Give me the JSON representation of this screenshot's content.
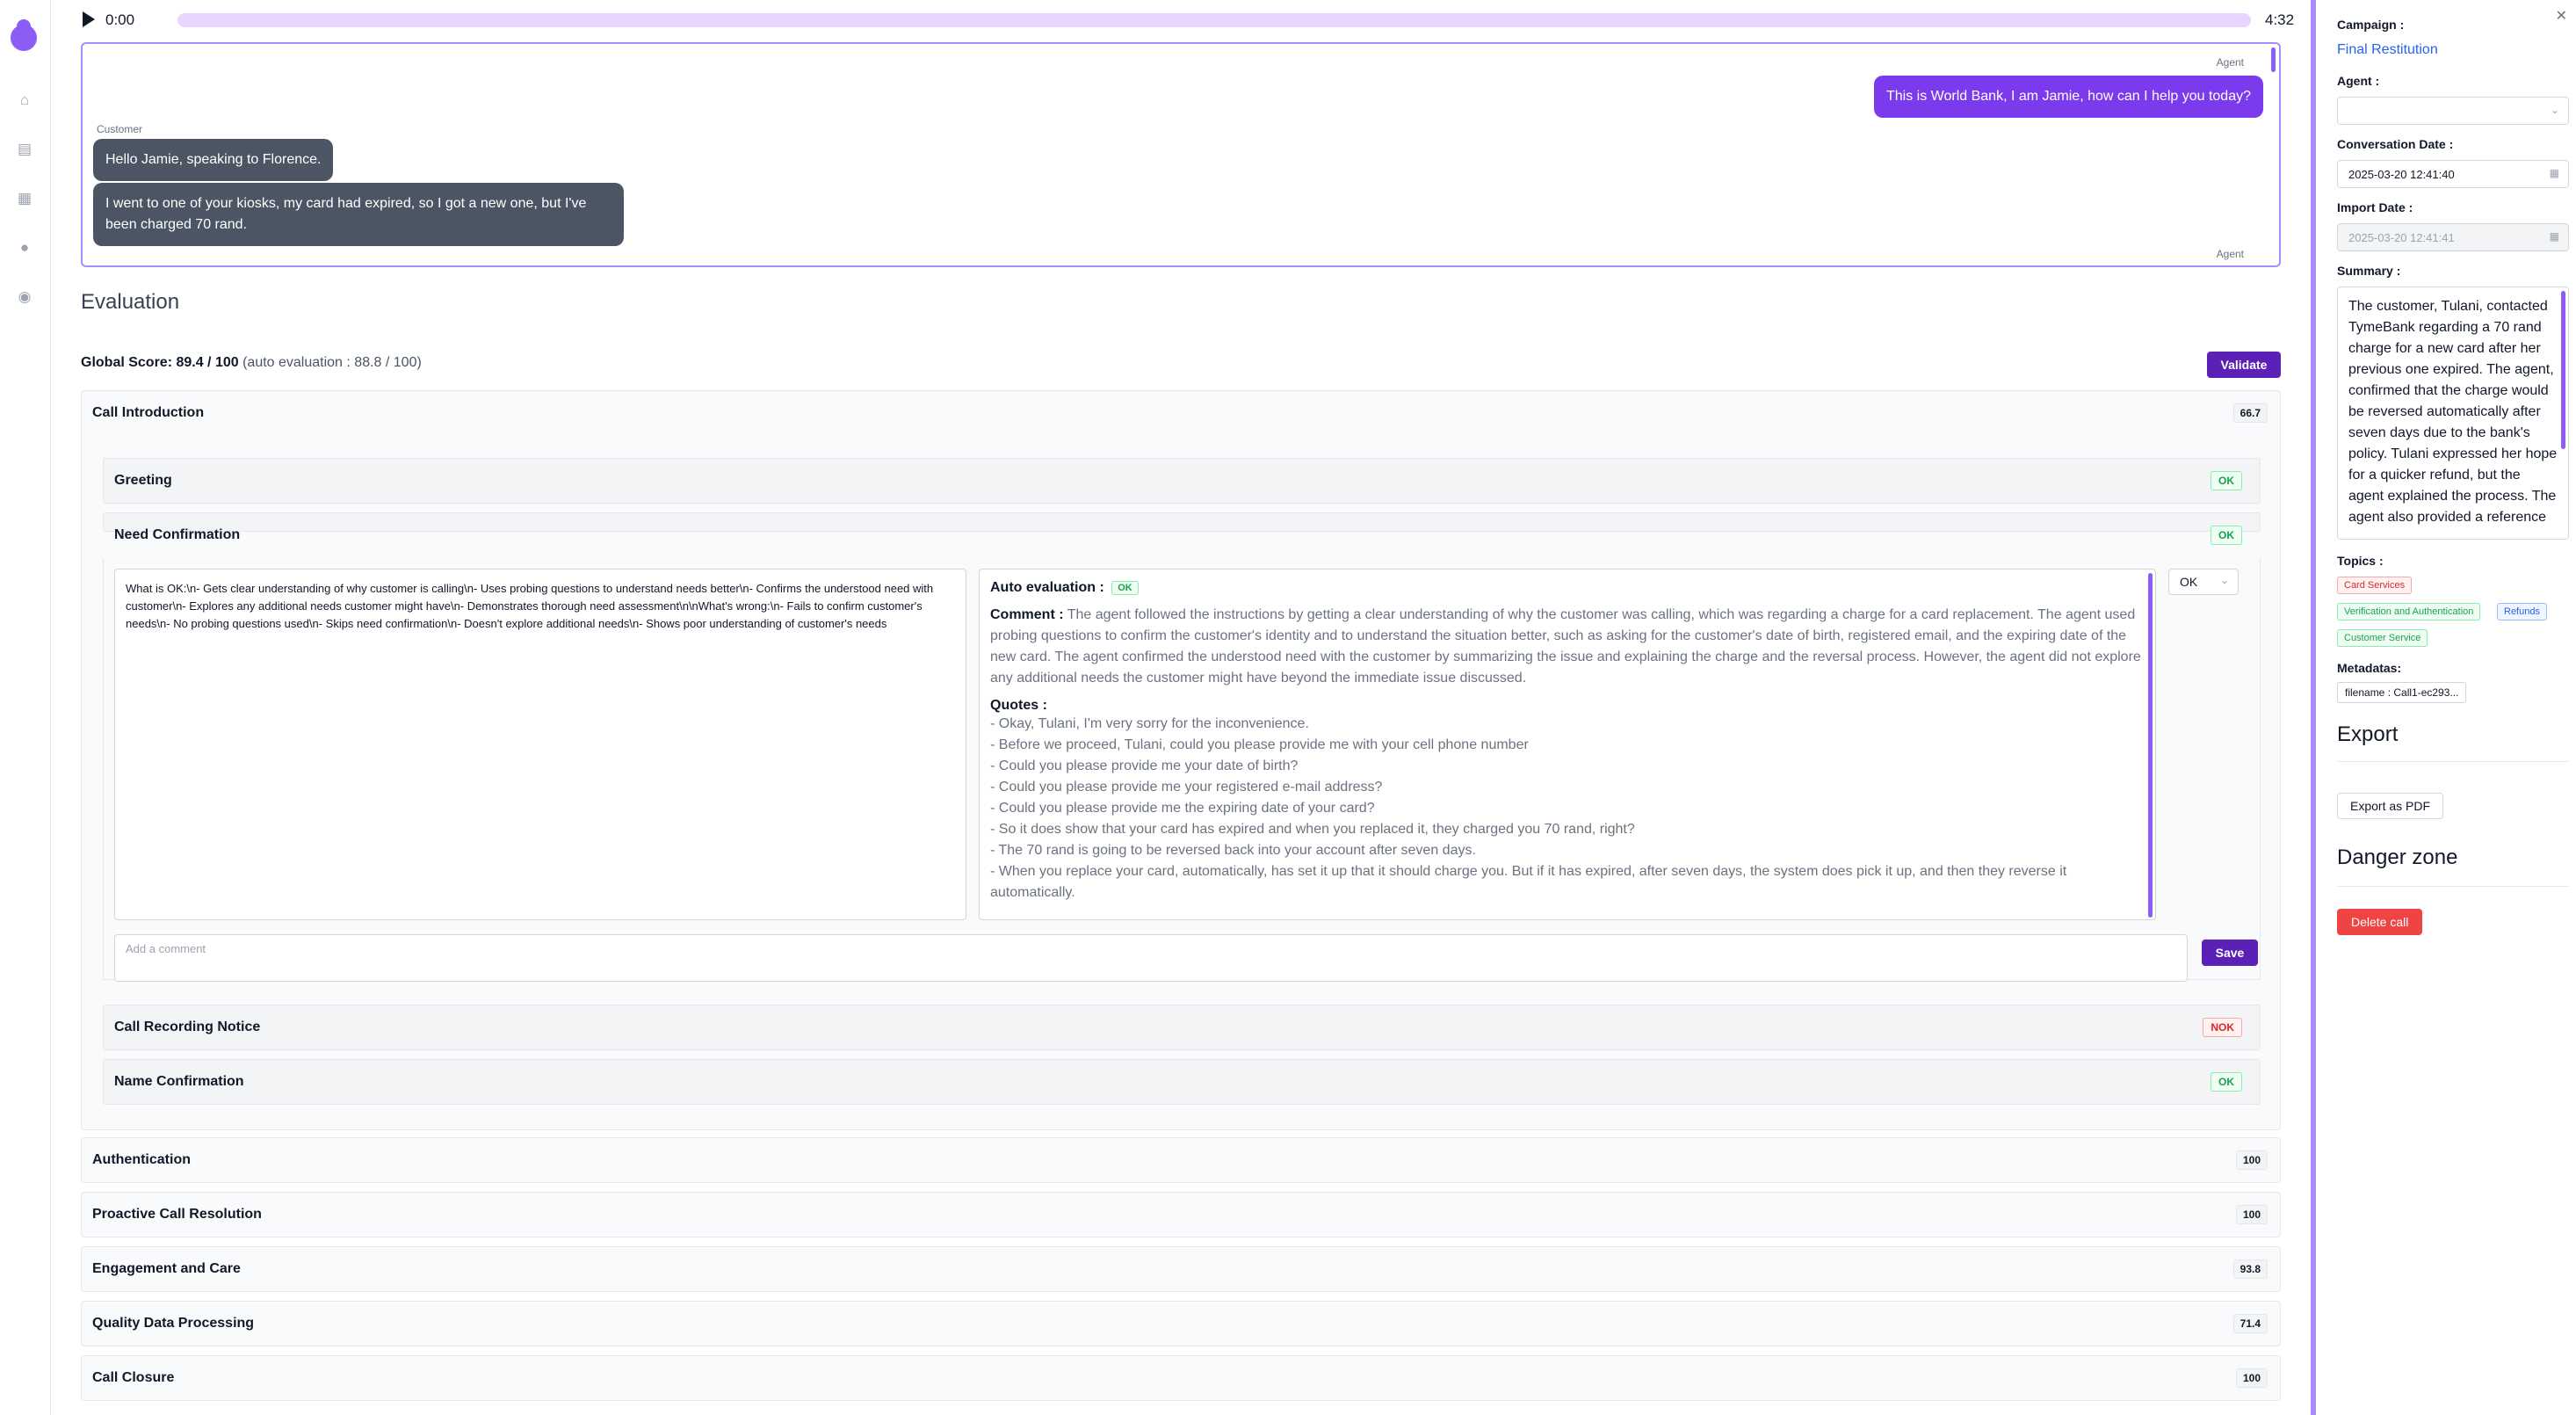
{
  "player": {
    "current_time": "0:00",
    "total_time": "4:32",
    "progress": 0.0
  },
  "transcript": {
    "messages": [
      {
        "speaker": "Agent",
        "text": "This is World Bank, I am Jamie, how can I help you today?"
      },
      {
        "speaker": "Customer",
        "text": "Hello Jamie, speaking to Florence."
      },
      {
        "speaker": "Customer",
        "text": "I went to one of your kiosks, my card had expired, so I got a new one, but I've been charged 70 rand."
      },
      {
        "speaker": "Agent",
        "text": ""
      }
    ]
  },
  "evaluation": {
    "title": "Evaluation",
    "global_score_label": "Global Score: 89.4 / 100",
    "auto_score_label": "(auto evaluation : 88.8 / 100)",
    "validate_label": "Validate",
    "groups": [
      {
        "name": "Call Introduction",
        "score": "66.7"
      },
      {
        "name": "Authentication",
        "score": "100"
      },
      {
        "name": "Proactive Call Resolution",
        "score": "100"
      },
      {
        "name": "Engagement and Care",
        "score": "93.8"
      },
      {
        "name": "Quality Data Processing",
        "score": "71.4"
      },
      {
        "name": "Call Closure",
        "score": "100"
      }
    ],
    "subcriteria": [
      {
        "name": "Greeting",
        "status": "OK"
      },
      {
        "name": "Need Confirmation",
        "status": "OK"
      },
      {
        "name": "Call Recording Notice",
        "status": "NOK"
      },
      {
        "name": "Name Confirmation",
        "status": "OK"
      }
    ],
    "expanded": {
      "criteria_text": "What is OK:\\n- Gets clear understanding of why customer is calling\\n- Uses probing questions to understand needs better\\n- Confirms the understood need with customer\\n- Explores any additional needs customer might have\\n- Demonstrates thorough need assessment\\n\\nWhat's wrong:\\n- Fails to confirm customer's needs\\n- No probing questions used\\n- Skips need confirmation\\n- Doesn't explore additional needs\\n- Shows poor understanding of customer's needs",
      "auto_eval_label": "Auto evaluation :",
      "auto_eval_status": "OK",
      "comment_label": "Comment :",
      "comment_text": "The agent followed the instructions by getting a clear understanding of why the customer was calling, which was regarding a charge for a card replacement. The agent used probing questions to confirm the customer's identity and to understand the situation better, such as asking for the customer's date of birth, registered email, and the expiring date of the new card. The agent confirmed the understood need with the customer by summarizing the issue and explaining the charge and the reversal process. However, the agent did not explore any additional needs the customer might have beyond the immediate issue discussed.",
      "quotes_label": "Quotes :",
      "quotes": [
        "- Okay, Tulani, I'm very sorry for the inconvenience.",
        "- Before we proceed, Tulani, could you please provide me with your cell phone number",
        "- Could you please provide me your date of birth?",
        "- Could you please provide me your registered e-mail address?",
        "- Could you please provide me the expiring date of your card?",
        "- So it does show that your card has expired and when you replaced it, they charged you 70 rand, right?",
        "- The 70 rand is going to be reversed back into your account after seven days.",
        "- When you replace your card, automatically,                      has set it up that it should charge you. But if it has expired, after seven days, the system does pick it up, and then they reverse it automatically."
      ],
      "select_value": "OK",
      "comment_placeholder": "Add a comment",
      "save_label": "Save"
    }
  },
  "panel": {
    "campaign_label": "Campaign :",
    "campaign_value": "Final Restitution",
    "agent_label": "Agent :",
    "agent_value": "",
    "conv_date_label": "Conversation Date :",
    "conv_date_value": "2025-03-20 12:41:40",
    "import_date_label": "Import Date :",
    "import_date_value": "2025-03-20 12:41:41",
    "summary_label": "Summary :",
    "summary_text": "The customer, Tulani, contacted TymeBank regarding a 70 rand charge for a new card after her previous one expired. The agent,              confirmed that the charge would be reversed automatically after seven days due to the bank's policy. Tulani expressed her hope for a quicker refund, but the agent explained the process. The agent also provided a reference",
    "topics_label": "Topics :",
    "topics": [
      "Card Services",
      "Verification and Authentication",
      "Refunds",
      "Customer Service"
    ],
    "metadatas_label": "Metadatas:",
    "metadata_chip": "filename : Call1-ec293...",
    "export_heading": "Export",
    "export_pdf_label": "Export as PDF",
    "danger_heading": "Danger zone",
    "delete_label": "Delete call"
  },
  "colors": {
    "accent": "#7c3aed",
    "ok": "#16a34a",
    "nok": "#dc2626",
    "danger": "#ef4444"
  }
}
